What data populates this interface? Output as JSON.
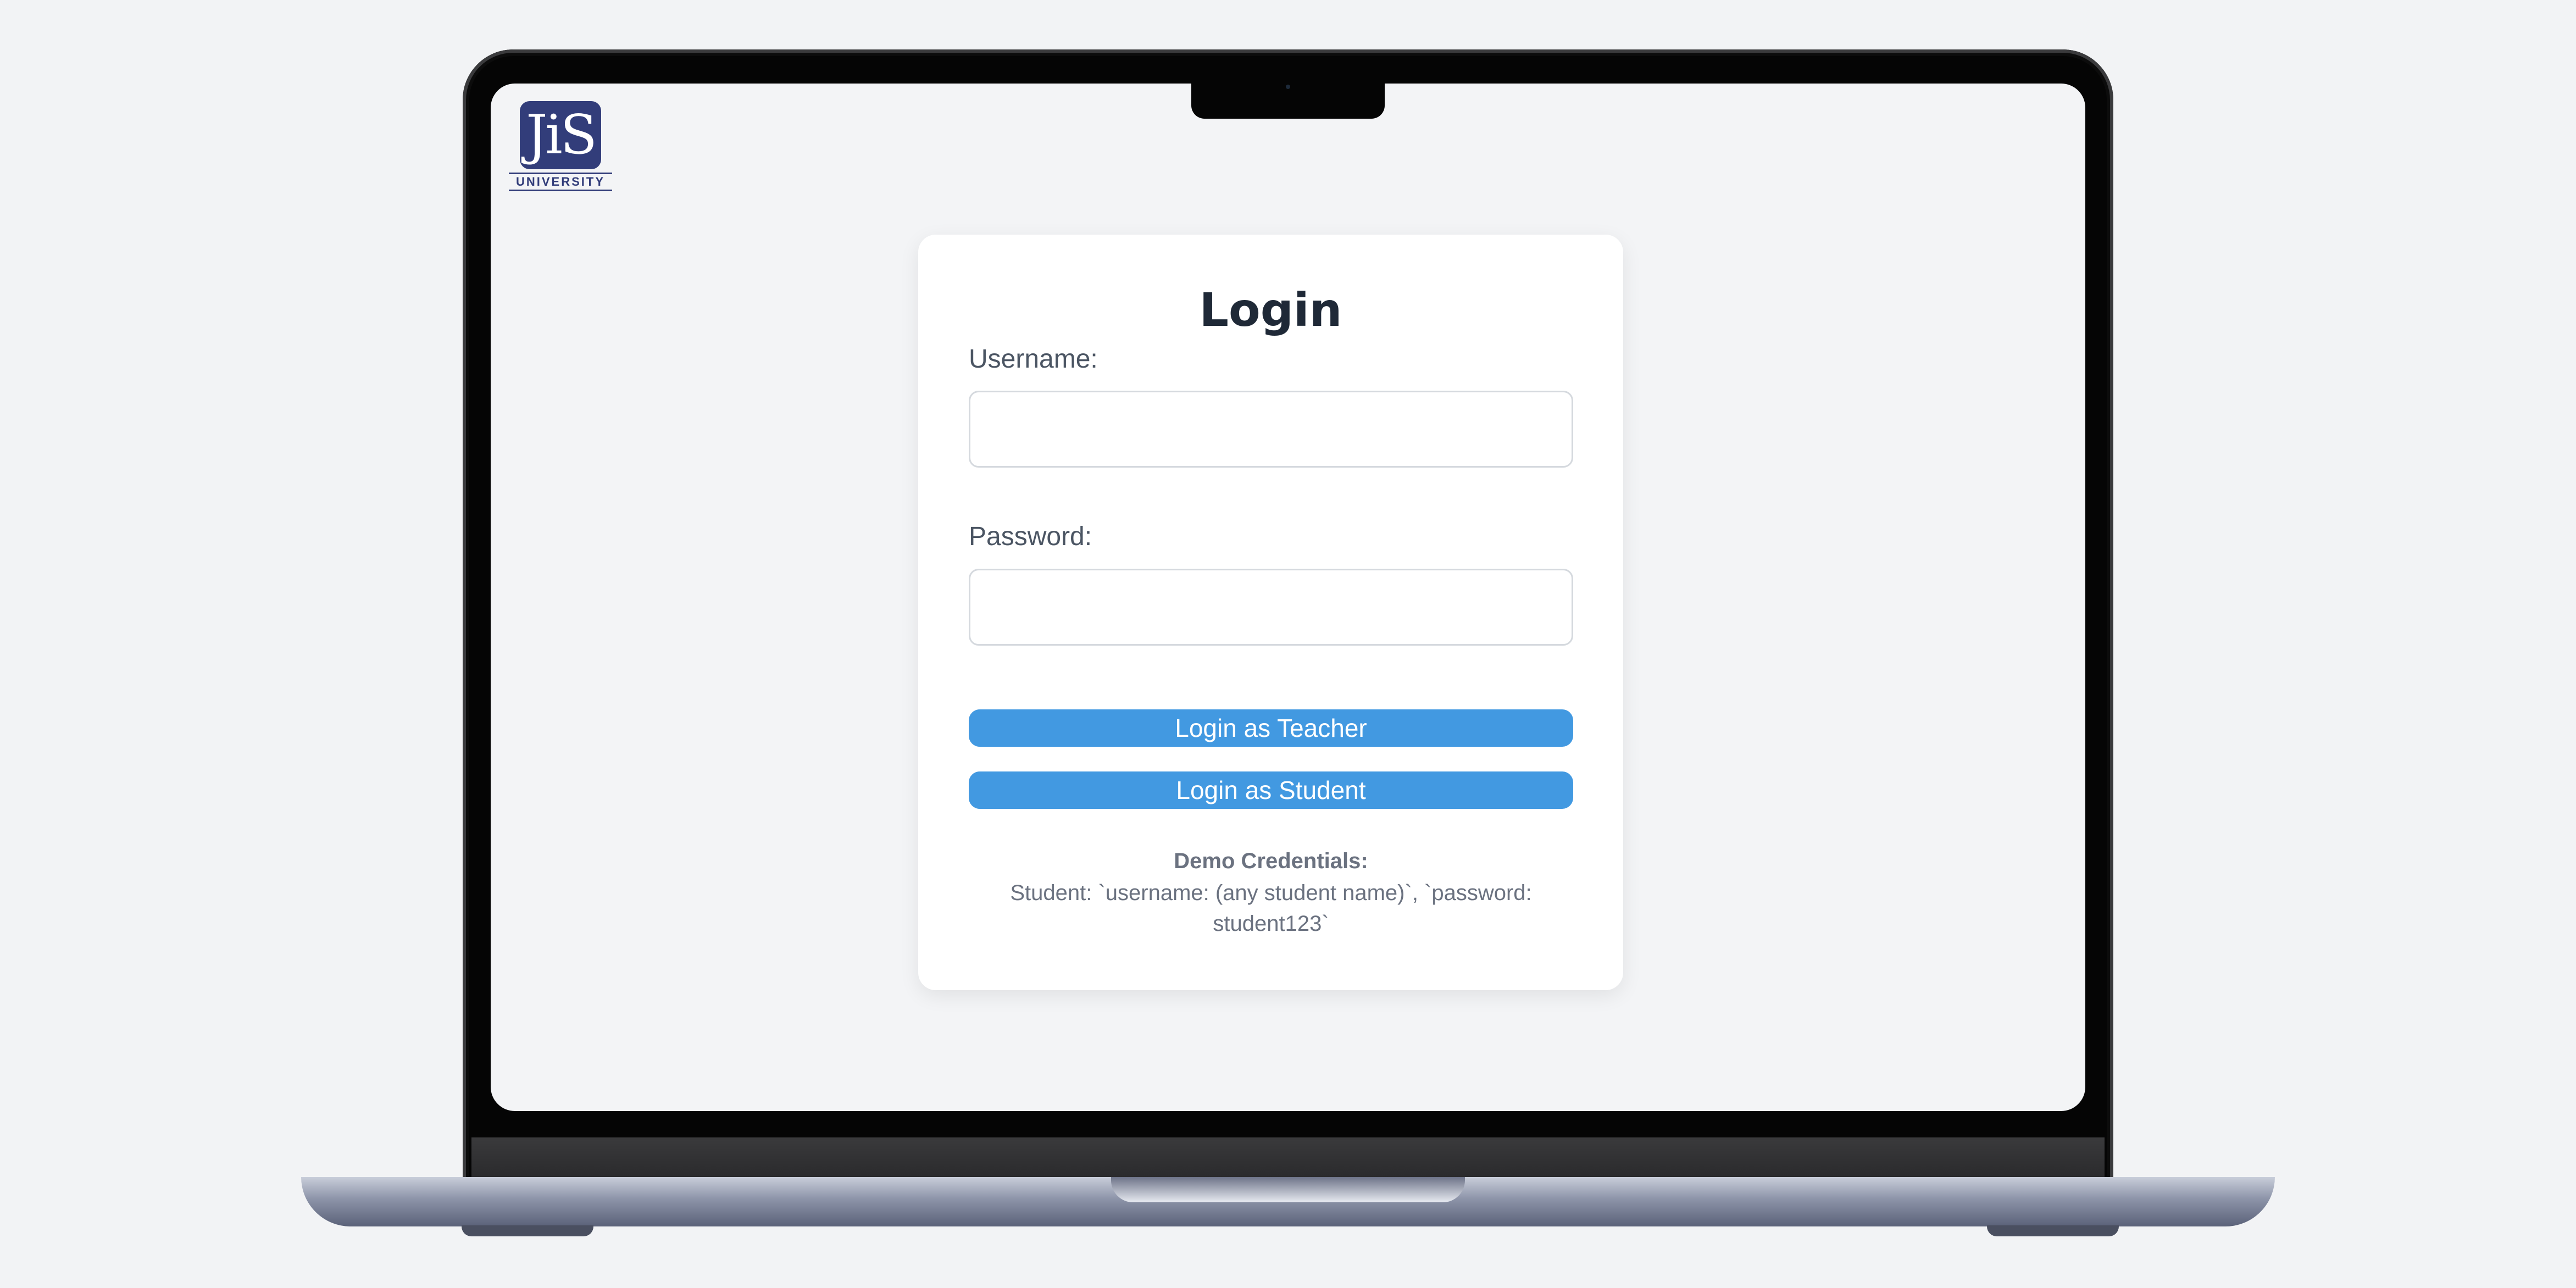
{
  "logo": {
    "mark_text": "JiS",
    "name": "UNIVERSITY"
  },
  "login": {
    "title": "Login",
    "username_label": "Username:",
    "username_value": "",
    "password_label": "Password:",
    "password_value": "",
    "teacher_button": "Login as Teacher",
    "student_button": "Login as Student"
  },
  "demo": {
    "heading": "Demo Credentials:",
    "line1": "Student: `username: (any student name)`, `password:",
    "line2": "student123`"
  },
  "colors": {
    "page_background": "#f3f4f6",
    "card_background": "#ffffff",
    "button": "#4299e1",
    "logo": "#323d7a"
  }
}
